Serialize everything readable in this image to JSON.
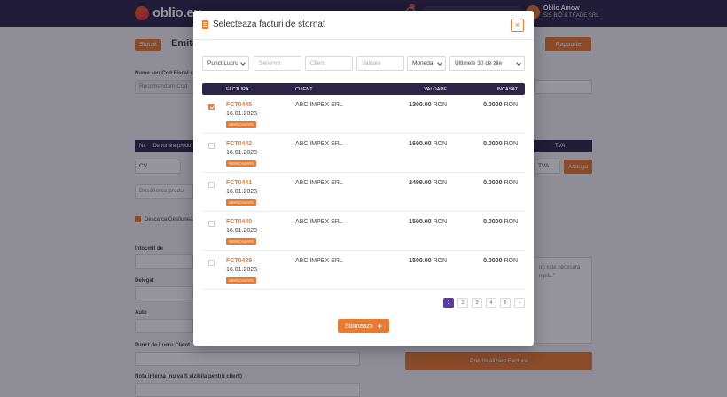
{
  "app": {
    "logo_text": "oblio.eu",
    "user_name": "Oblio Amow",
    "user_company": "SIS BIO & TRADE SRL"
  },
  "background": {
    "badge": "Stocat",
    "title": "Emite",
    "reports_button": "Rapoarte",
    "label_client": "Nume sau Cod Fiscal cl",
    "client_placeholder": "Recomandam Cod",
    "table_col_nr": "Nr.",
    "table_col_product": "Denumire produ",
    "table_col_tva": "TVA",
    "unit_value": "CV",
    "tva_value": "TVA",
    "add_button": "Adauga",
    "product_desc_placeholder": "Descrierea produ",
    "stock_checkbox_label": "Descarca Gestiunea",
    "label_issued_by": "Intocmit de",
    "label_delegate": "Delegat",
    "label_car": "Auto",
    "label_work_point": "Punct de Lucru Client",
    "label_internal_note": "Nota interna (nu va fi vizibila pentru client)",
    "note_text_1": "nu este necesara",
    "note_text_2": "mpila.\"",
    "preview_button": "Previzualizare Factura"
  },
  "modal": {
    "title": "Selecteaza facturi de stornat",
    "close_label": "×",
    "filters": {
      "work_point": "Punct Lucru",
      "series_placeholder": "Serie+nr",
      "client_placeholder": "Client",
      "value_placeholder": "Valoare",
      "currency": "Moneda",
      "period": "Ultimele 30 de zile"
    },
    "columns": {
      "invoice": "FACTURA",
      "client": "CLIENT",
      "value": "VALOARE",
      "paid": "INCASAT"
    },
    "rows": [
      {
        "number": "FCT0445",
        "date": "16.01.2023",
        "status": "NEINCASATA",
        "client": "ABC IMPEX SRL",
        "value": "1300.00",
        "currency": "RON",
        "paid": "0.0000",
        "checked": true
      },
      {
        "number": "FCT0442",
        "date": "16.01.2023",
        "status": "NEINCASATA",
        "client": "ABC IMPEX SRL",
        "value": "1600.00",
        "currency": "RON",
        "paid": "0.0000",
        "checked": false
      },
      {
        "number": "FCT0441",
        "date": "16.01.2023",
        "status": "NEINCASATA",
        "client": "ABC IMPEX SRL",
        "value": "2499.00",
        "currency": "RON",
        "paid": "0.0000",
        "checked": false
      },
      {
        "number": "FCT0440",
        "date": "16.01.2023",
        "status": "NEINCASATA",
        "client": "ABC IMPEX SRL",
        "value": "1500.00",
        "currency": "RON",
        "paid": "0.0000",
        "checked": false
      },
      {
        "number": "FCT0439",
        "date": "16.01.2023",
        "status": "NEINCASATA",
        "client": "ABC IMPEX SRL",
        "value": "1500.00",
        "currency": "RON",
        "paid": "0.0000",
        "checked": false
      }
    ],
    "pagination": {
      "pages": [
        "1",
        "2",
        "3",
        "4",
        "5"
      ],
      "active": "1",
      "next": "›"
    },
    "submit_label": "Storneaza",
    "submit_icon": "+"
  },
  "colors": {
    "accent": "#e97a2f",
    "header": "#2c2547",
    "active_page": "#5b3b9b"
  }
}
